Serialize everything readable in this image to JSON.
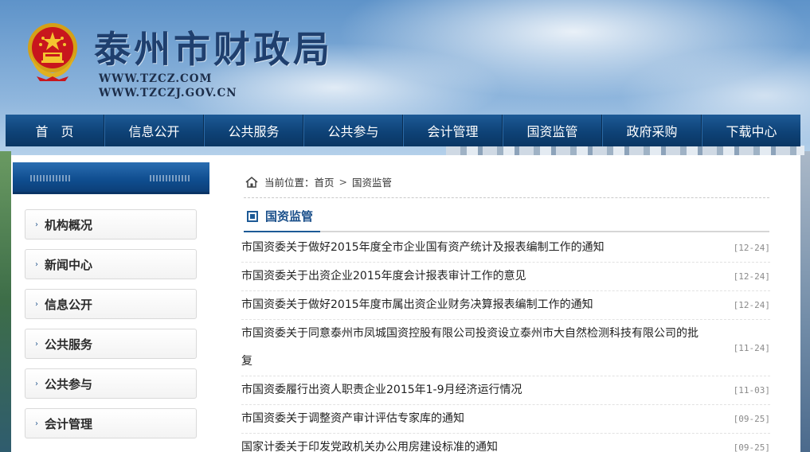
{
  "header": {
    "title": "泰州市财政局",
    "url1": "WWW.TZCZ.COM",
    "url2": "WWW.TZCZJ.GOV.CN",
    "emblem_icon": "national-emblem-icon"
  },
  "nav": {
    "items": [
      {
        "label": "首　页"
      },
      {
        "label": "信息公开"
      },
      {
        "label": "公共服务"
      },
      {
        "label": "公共参与"
      },
      {
        "label": "会计管理"
      },
      {
        "label": "国资监管"
      },
      {
        "label": "政府采购"
      },
      {
        "label": "下载中心"
      }
    ]
  },
  "sidebar": {
    "items": [
      {
        "label": "机构概况"
      },
      {
        "label": "新闻中心"
      },
      {
        "label": "信息公开"
      },
      {
        "label": "公共服务"
      },
      {
        "label": "公共参与"
      },
      {
        "label": "会计管理"
      }
    ]
  },
  "breadcrumb": {
    "prefix": "当前位置：",
    "home": "首页",
    "separator": ">",
    "current": "国资监管"
  },
  "section": {
    "title": "国资监管"
  },
  "news": [
    {
      "title": "市国资委关于做好2015年度全市企业国有资产统计及报表编制工作的通知",
      "date": "[12-24]"
    },
    {
      "title": "市国资委关于出资企业2015年度会计报表审计工作的意见",
      "date": "[12-24]"
    },
    {
      "title": "市国资委关于做好2015年度市属出资企业财务决算报表编制工作的通知",
      "date": "[12-24]"
    },
    {
      "title": "市国资委关于同意泰州市凤城国资控股有限公司投资设立泰州市大自然检测科技有限公司的批复",
      "date": "[11-24]"
    },
    {
      "title": "市国资委履行出资人职责企业2015年1-9月经济运行情况",
      "date": "[11-03]"
    },
    {
      "title": "市国资委关于调整资产审计评估专家库的通知",
      "date": "[09-25]"
    },
    {
      "title": "国家计委关于印发党政机关办公用房建设标准的通知",
      "date": "[09-25]"
    }
  ],
  "colors": {
    "nav_bg": "#0e4277",
    "accent": "#1d5a96",
    "title": "#1f3f6e"
  }
}
